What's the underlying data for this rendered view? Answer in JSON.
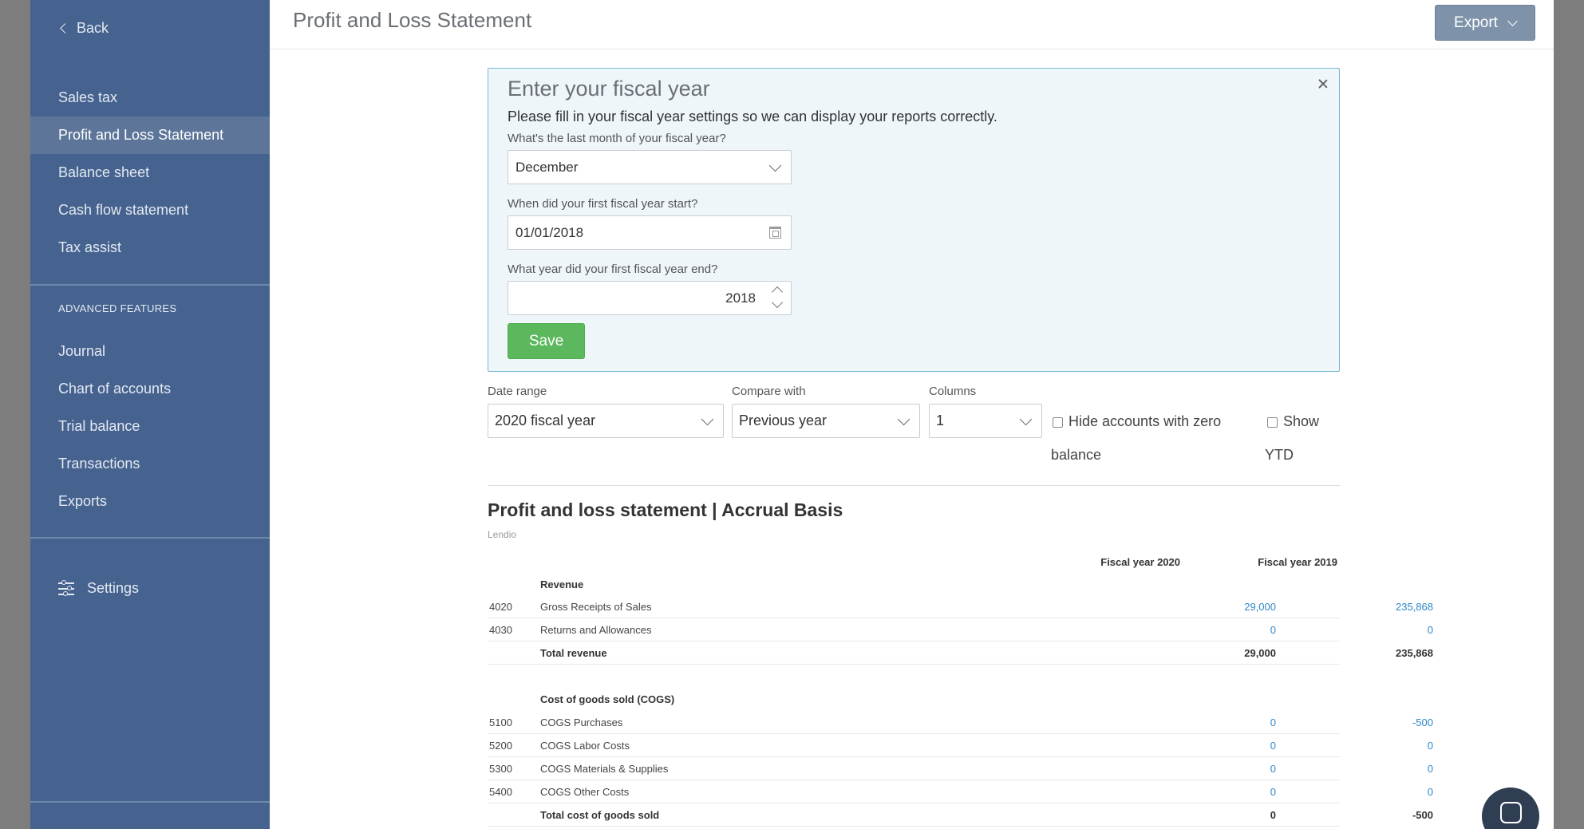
{
  "sidebar": {
    "back_label": "Back",
    "items": [
      {
        "label": "Sales tax"
      },
      {
        "label": "Profit and Loss Statement",
        "active": true
      },
      {
        "label": "Balance sheet"
      },
      {
        "label": "Cash flow statement"
      },
      {
        "label": "Tax assist"
      }
    ],
    "advanced_title": "ADVANCED FEATURES",
    "advanced_items": [
      {
        "label": "Journal"
      },
      {
        "label": "Chart of accounts"
      },
      {
        "label": "Trial balance"
      },
      {
        "label": "Transactions"
      },
      {
        "label": "Exports"
      }
    ],
    "settings_label": "Settings",
    "settings_icon": "sliders-icon"
  },
  "header": {
    "title": "Profit and Loss Statement",
    "export_label": "Export"
  },
  "fiscal_panel": {
    "title": "Enter your fiscal year",
    "subtitle": "Please fill in your fiscal year settings so we can display your reports correctly.",
    "last_month_label": "What's the last month of your fiscal year?",
    "last_month_value": "December",
    "start_label": "When did your first fiscal year start?",
    "start_value": "01/01/2018",
    "end_label": "What year did your first fiscal year end?",
    "end_value": "2018",
    "save_label": "Save"
  },
  "filters": {
    "date_range_label": "Date range",
    "date_range_value": "2020 fiscal year",
    "compare_label": "Compare with",
    "compare_value": "Previous year",
    "columns_label": "Columns",
    "columns_value": "1",
    "hide_zero_label_1": "Hide accounts with zero",
    "hide_zero_label_2": "balance",
    "show_ytd_label_1": "Show",
    "show_ytd_label_2": "YTD"
  },
  "report": {
    "title": "Profit and loss statement | Accrual Basis",
    "company": "Lendio",
    "columns": [
      "Fiscal year 2020",
      "Fiscal year 2019"
    ],
    "revenue_heading": "Revenue",
    "revenue_rows": [
      {
        "code": "4020",
        "name": "Gross Receipts of Sales",
        "v1": "29,000",
        "v2": "235,868"
      },
      {
        "code": "4030",
        "name": "Returns and Allowances",
        "v1": "0",
        "v2": "0"
      }
    ],
    "revenue_total": {
      "name": "Total revenue",
      "v1": "29,000",
      "v2": "235,868"
    },
    "cogs_heading": "Cost of goods sold (COGS)",
    "cogs_rows": [
      {
        "code": "5100",
        "name": "COGS Purchases",
        "v1": "0",
        "v2": "-500"
      },
      {
        "code": "5200",
        "name": "COGS Labor Costs",
        "v1": "0",
        "v2": "0"
      },
      {
        "code": "5300",
        "name": "COGS Materials & Supplies",
        "v1": "0",
        "v2": "0"
      },
      {
        "code": "5400",
        "name": "COGS Other Costs",
        "v1": "0",
        "v2": "0"
      }
    ],
    "cogs_total": {
      "name": "Total cost of goods sold",
      "v1": "0",
      "v2": "-500"
    }
  },
  "colors": {
    "sidebar_bg": "#46638f",
    "sidebar_active": "#5c7599",
    "save_green": "#5cb85c",
    "link_blue": "#2d87c8",
    "export_btn": "#7e93aa"
  }
}
